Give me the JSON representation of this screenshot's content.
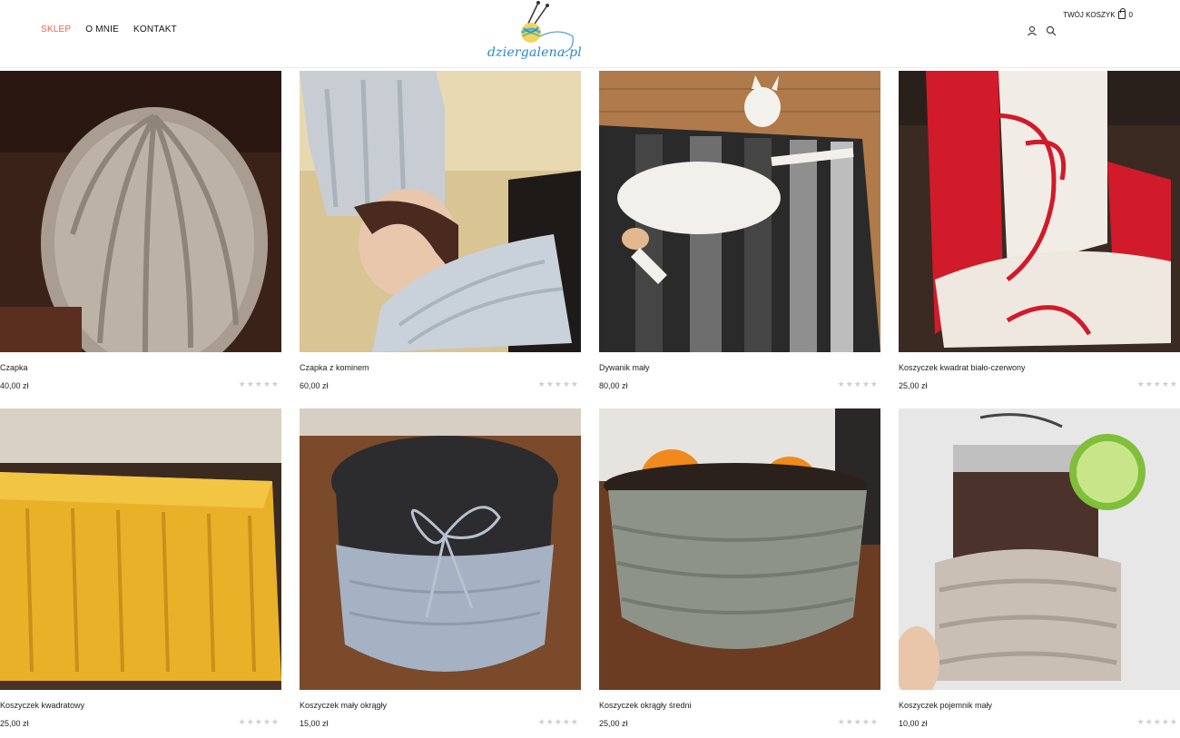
{
  "header": {
    "nav": [
      {
        "label": "SKLEP",
        "active": true
      },
      {
        "label": "O MNIE",
        "active": false
      },
      {
        "label": "KONTAKT",
        "active": false
      }
    ],
    "logo_text": "dziergalena.pl",
    "cart_label": "TWÓJ KOSZYK",
    "cart_count": "0",
    "icons": [
      "user-icon",
      "search-icon",
      "cart-bag-icon"
    ]
  },
  "colors": {
    "accent": "#e8634f",
    "logo_blue": "#2a86c9",
    "star": "#cfcfcf"
  },
  "products": [
    {
      "title": "Czapka",
      "price": "40,00 zł",
      "rating_stars": "★★★★★",
      "image": "knitted-hat"
    },
    {
      "title": "Czapka z kominem",
      "price": "60,00 zł",
      "rating_stars": "★★★★★",
      "image": "hat-and-scarf-woman"
    },
    {
      "title": "Dywanik mały",
      "price": "80,00 zł",
      "rating_stars": "★★★★★",
      "image": "cat-on-striped-rug"
    },
    {
      "title": "Koszyczek kwadrat biało-czerwony",
      "price": "25,00 zł",
      "rating_stars": "★★★★★",
      "image": "red-white-basket"
    },
    {
      "title": "Koszyczek kwadratowy",
      "price": "25,00 zł",
      "rating_stars": "★★★★★",
      "image": "yellow-square-basket"
    },
    {
      "title": "Koszyczek mały okrągły",
      "price": "15,00 zł",
      "rating_stars": "★★★★★",
      "image": "grey-round-basket"
    },
    {
      "title": "Koszyczek okrągły średni",
      "price": "25,00 zł",
      "rating_stars": "★★★★★",
      "image": "basket-with-oranges"
    },
    {
      "title": "Koszyczek pojemnik mały",
      "price": "10,00 zł",
      "rating_stars": "★★★★★",
      "image": "glass-holder-cozy"
    }
  ]
}
